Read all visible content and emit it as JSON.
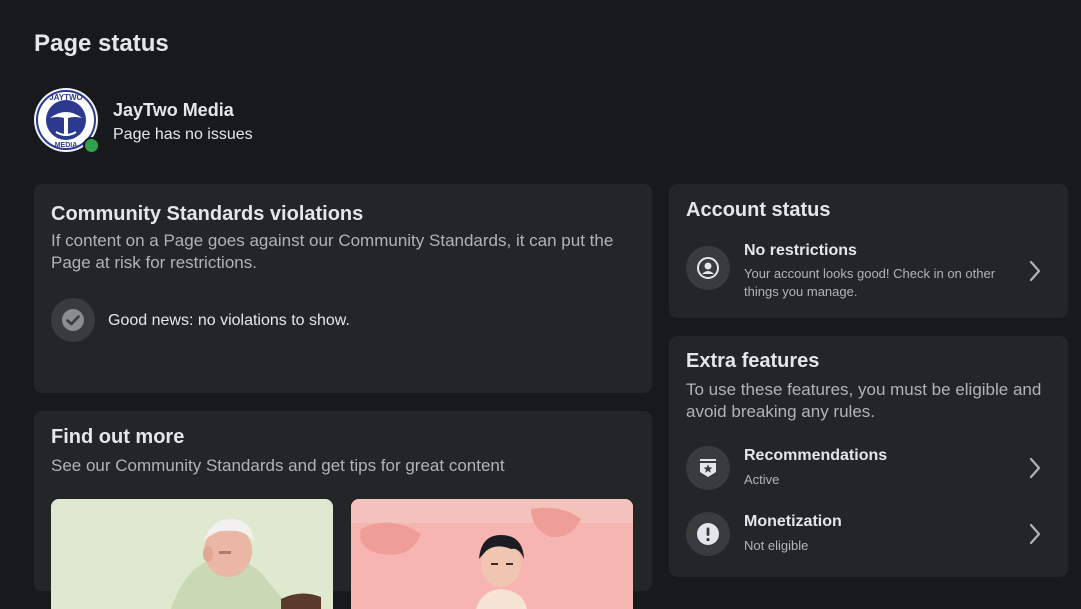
{
  "page": {
    "title": "Page status"
  },
  "profile": {
    "name": "JayTwo Media",
    "status": "Page has no issues",
    "logo_top_text": "JAYTWO",
    "logo_bottom_text": "MEDIA"
  },
  "community": {
    "title": "Community Standards violations",
    "description": "If content on a Page goes against our Community Standards, it can put the Page at risk for restrictions.",
    "good_news": "Good news: no violations to show."
  },
  "find_out": {
    "title": "Find out more",
    "description": "See our Community Standards and get tips for great content"
  },
  "account": {
    "title": "Account status",
    "item_title": "No restrictions",
    "item_sub": "Your account looks good! Check in on other things you manage."
  },
  "extra": {
    "title": "Extra features",
    "description": "To use these features, you must be eligible and avoid breaking any rules.",
    "items": [
      {
        "title": "Recommendations",
        "status": "Active",
        "icon": "star-badge-icon"
      },
      {
        "title": "Monetization",
        "status": "Not eligible",
        "icon": "exclamation-icon"
      }
    ]
  },
  "colors": {
    "background": "#18191a",
    "card": "#242526",
    "text_primary": "#e4e6eb",
    "text_secondary": "#b0b3b8",
    "icon_bg": "#3a3b3c",
    "online_green": "#31a24c",
    "logo_blue": "#2b3a8f"
  }
}
